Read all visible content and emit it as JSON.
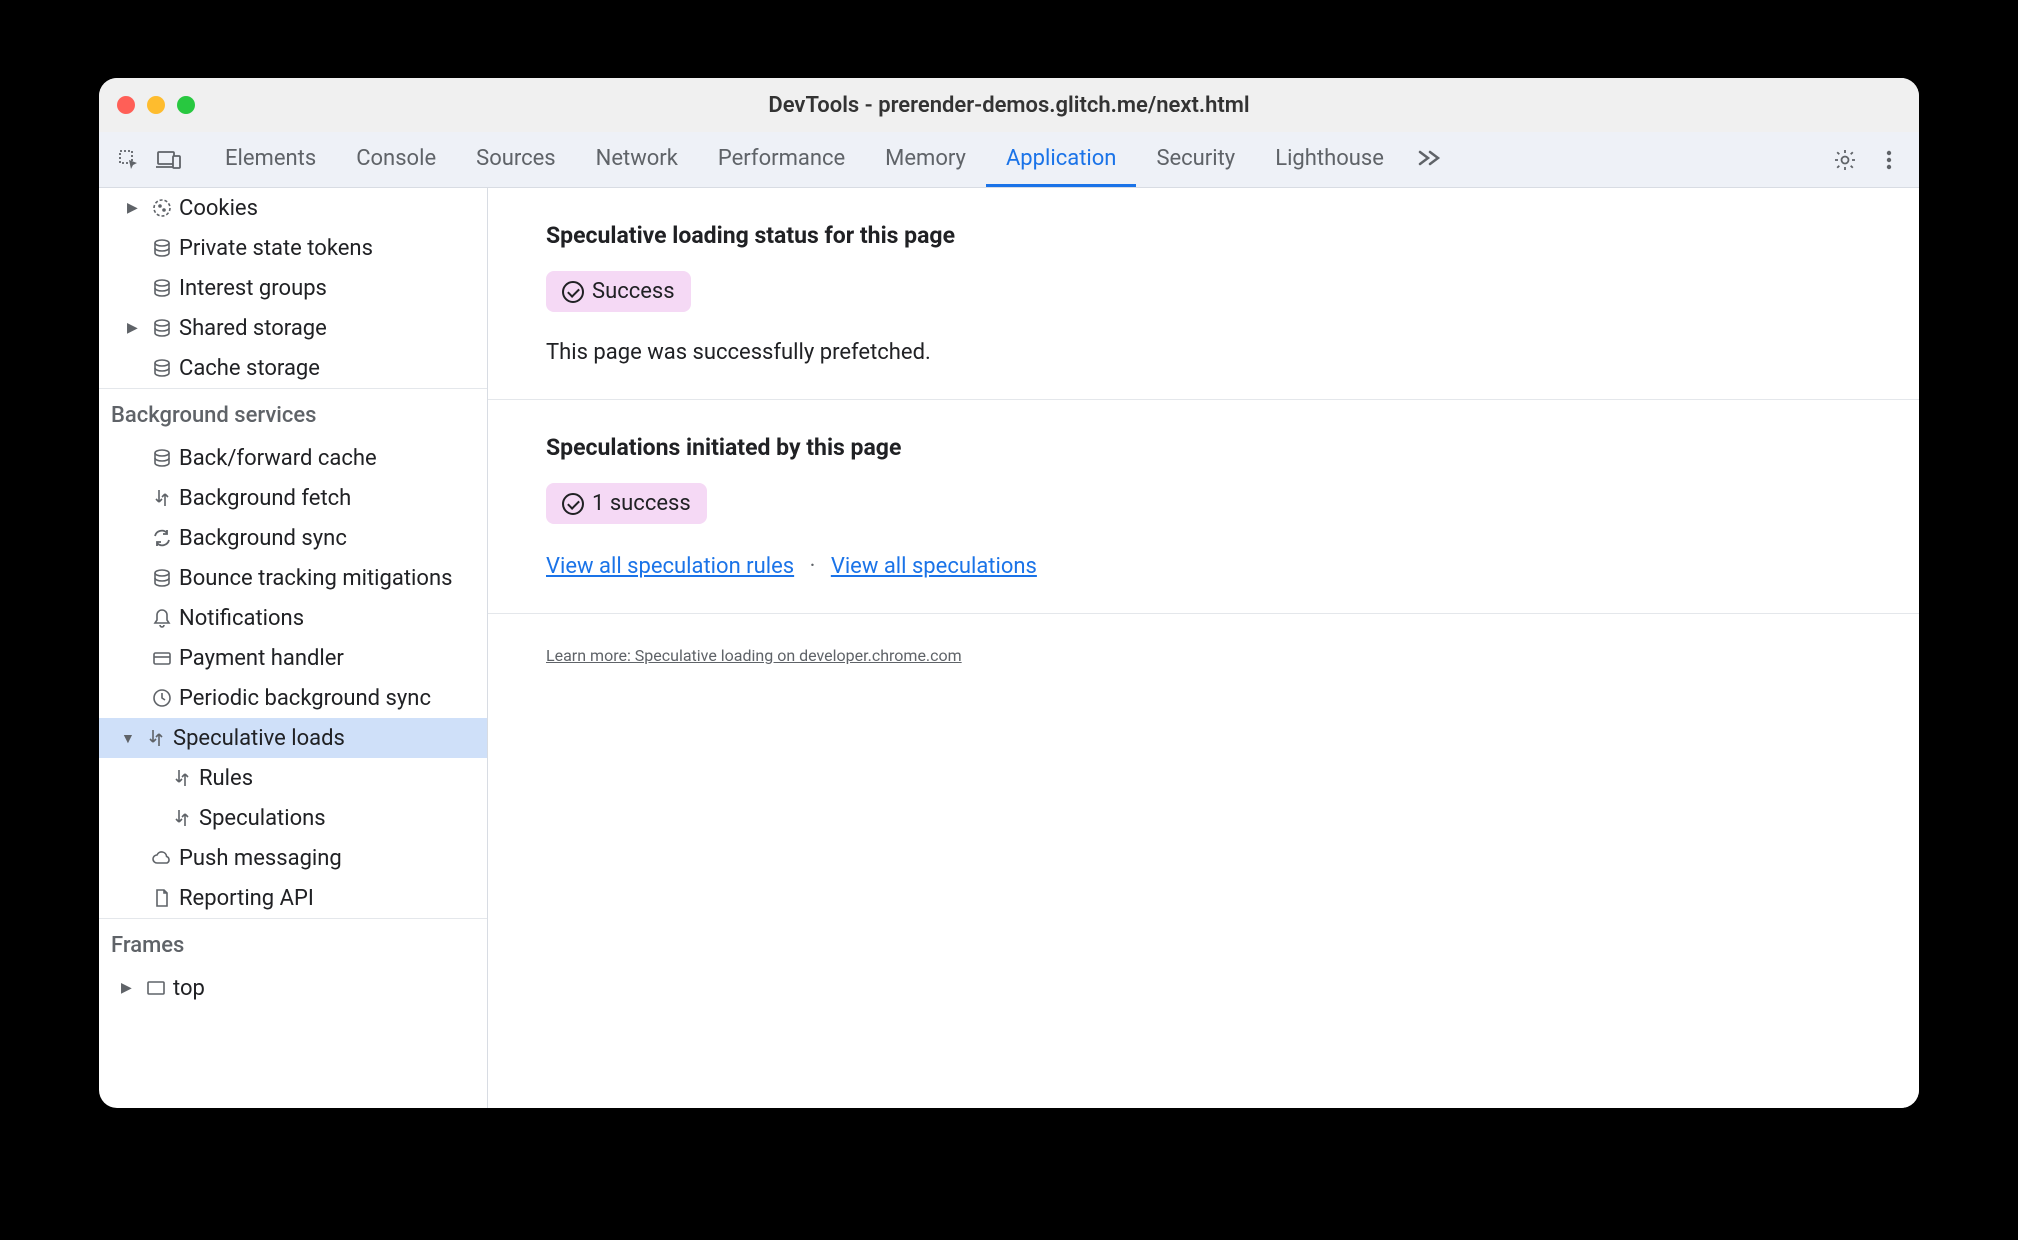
{
  "window": {
    "title": "DevTools - prerender-demos.glitch.me/next.html"
  },
  "tabs": {
    "elements": "Elements",
    "console": "Console",
    "sources": "Sources",
    "network": "Network",
    "performance": "Performance",
    "memory": "Memory",
    "application": "Application",
    "security": "Security",
    "lighthouse": "Lighthouse"
  },
  "sidebar": {
    "storage": {
      "cookies": "Cookies",
      "private_state_tokens": "Private state tokens",
      "interest_groups": "Interest groups",
      "shared_storage": "Shared storage",
      "cache_storage": "Cache storage"
    },
    "bg_header": "Background services",
    "bg": {
      "back_forward_cache": "Back/forward cache",
      "background_fetch": "Background fetch",
      "background_sync": "Background sync",
      "bounce_tracking": "Bounce tracking mitigations",
      "notifications": "Notifications",
      "payment_handler": "Payment handler",
      "periodic_sync": "Periodic background sync",
      "speculative_loads": "Speculative loads",
      "rules": "Rules",
      "speculations": "Speculations",
      "push_messaging": "Push messaging",
      "reporting_api": "Reporting API"
    },
    "frames_header": "Frames",
    "frames": {
      "top": "top"
    }
  },
  "main": {
    "status_heading": "Speculative loading status for this page",
    "status_badge": "Success",
    "status_text": "This page was successfully prefetched.",
    "initiated_heading": "Speculations initiated by this page",
    "initiated_badge": "1 success",
    "link_rules": "View all speculation rules",
    "link_speculations": "View all speculations",
    "learn_more": "Learn more: Speculative loading on developer.chrome.com"
  }
}
